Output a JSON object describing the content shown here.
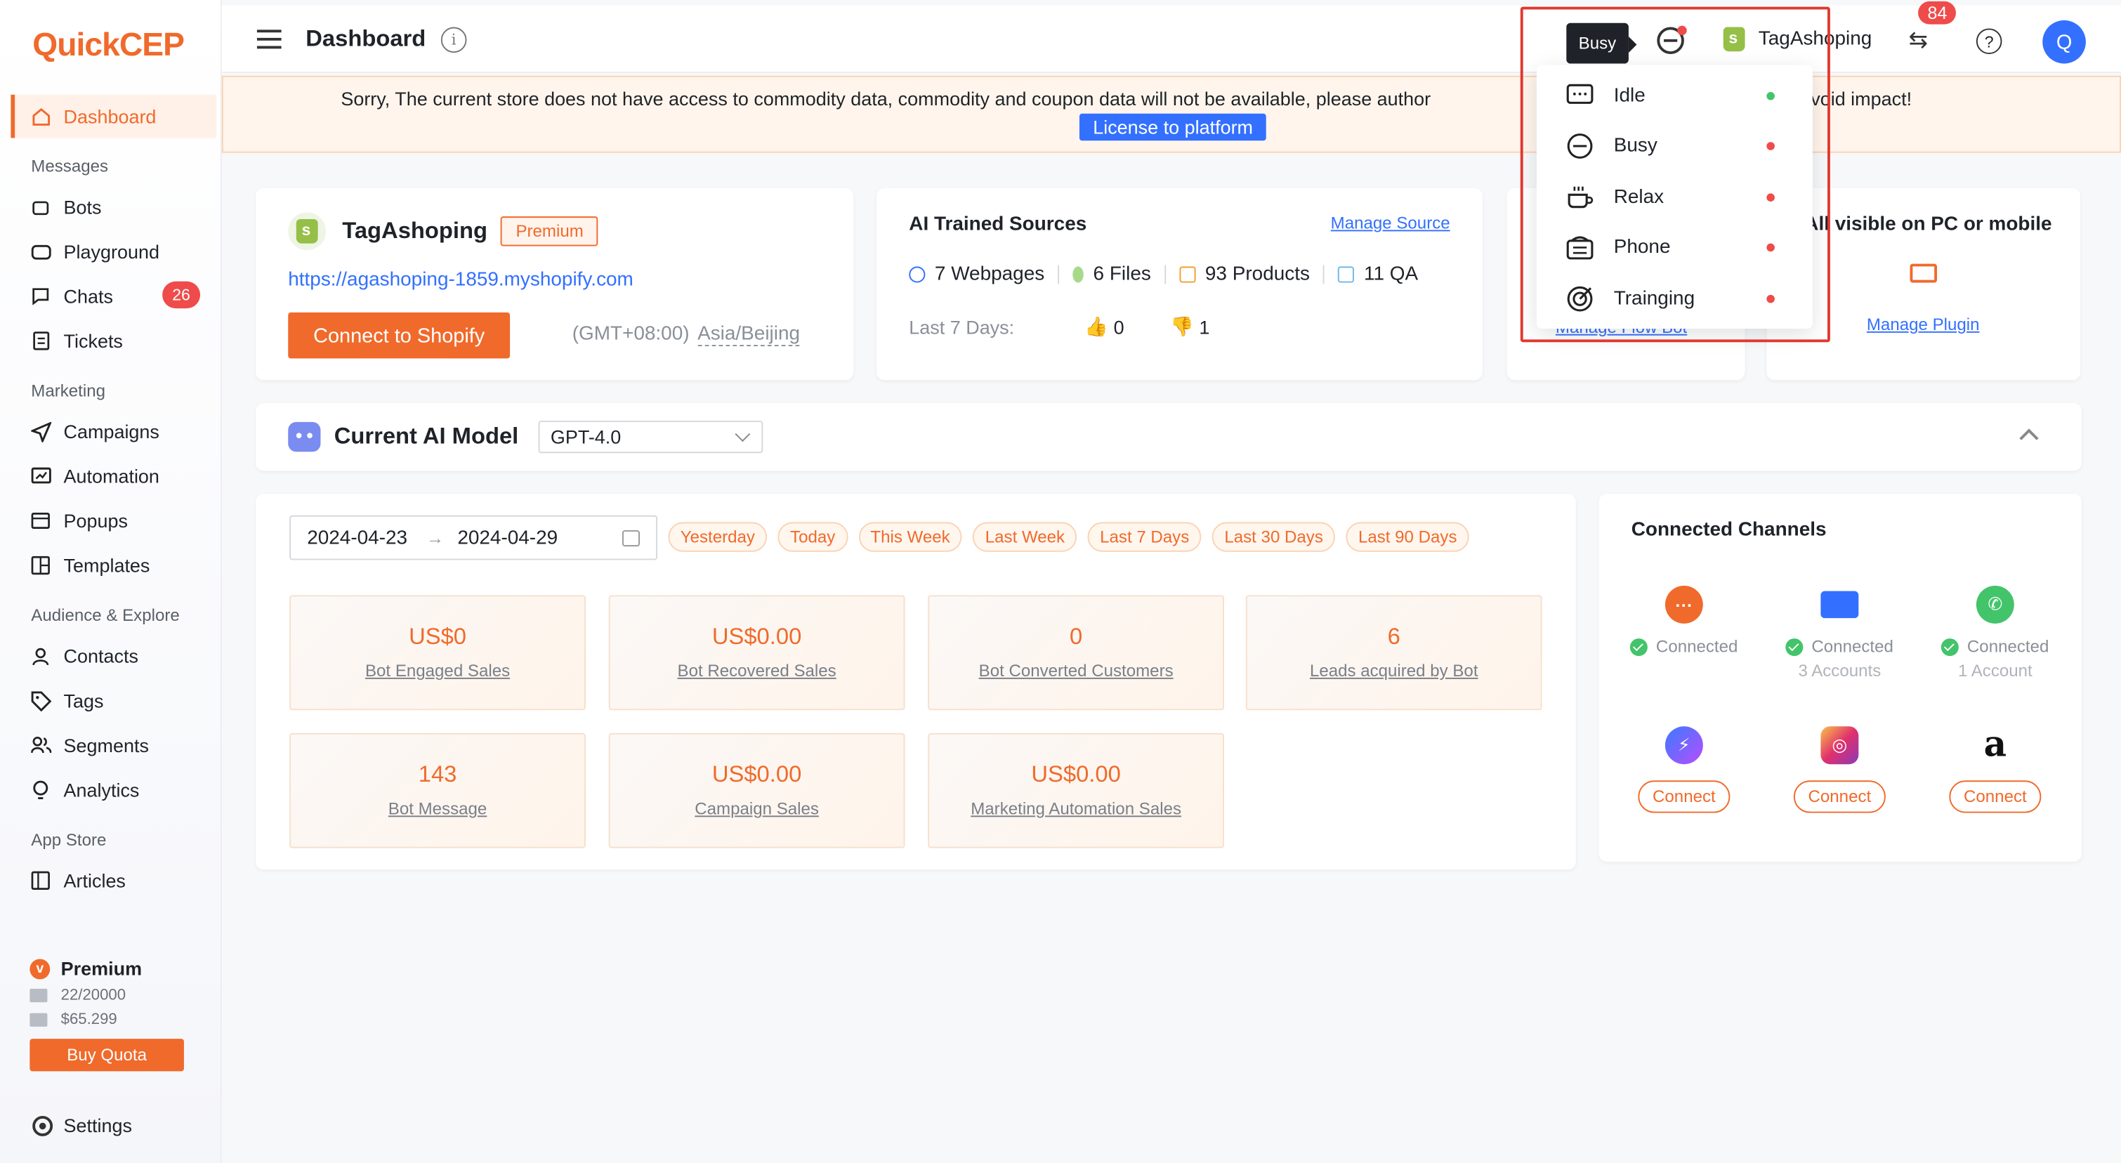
{
  "app": {
    "logo_text": "QuickCEP",
    "brand_color": "#f06a2b",
    "accent_color": "#3370ff"
  },
  "sidebar": {
    "dashboard": "Dashboard",
    "sections": {
      "messages": "Messages",
      "marketing": "Marketing",
      "audience": "Audience & Explore",
      "app_store": "App Store"
    },
    "items": {
      "bots": "Bots",
      "playground": "Playground",
      "chats": "Chats",
      "chats_badge": "26",
      "tickets": "Tickets",
      "campaigns": "Campaigns",
      "automation": "Automation",
      "popups": "Popups",
      "templates": "Templates",
      "contacts": "Contacts",
      "tags": "Tags",
      "segments": "Segments",
      "analytics": "Analytics",
      "articles": "Articles"
    },
    "plan": {
      "name": "Premium",
      "quota_messages": "22/20000",
      "quota_balance": "$65.299",
      "buy_label": "Buy Quota"
    },
    "settings": "Settings"
  },
  "header": {
    "title": "Dashboard",
    "info_glyph": "i",
    "store_name": "TagAshoping",
    "notifications": "84",
    "avatar_letter": "Q",
    "help_glyph": "?"
  },
  "banner": {
    "text_left": "Sorry, The current store does not have access to commodity data, commodity and coupon data will not be available, please author",
    "text_right": "order to avoid impact!",
    "button": "License to platform"
  },
  "store_card": {
    "name": "TagAshoping",
    "tag": "Premium",
    "url": "https://agashoping-1859.myshopify.com",
    "connect_label": "Connect to Shopify",
    "timezone": "(GMT+08:00)",
    "city": "Asia/Beijing"
  },
  "ai_sources": {
    "title": "AI Trained Sources",
    "manage_link": "Manage Source",
    "webpages_count": "7",
    "webpages_label": "Webpages",
    "files_count": "6",
    "files_label": "Files",
    "products_count": "93",
    "products_label": "Products",
    "qa_count": "11",
    "qa_label": "QA",
    "last7_label": "Last 7 Days:",
    "thumbs_up": "0",
    "thumbs_down": "1"
  },
  "flow_card": {
    "link": "Manage Flow Bot"
  },
  "plugin_card": {
    "title": "All visible on PC or mobile",
    "link": "Manage Plugin"
  },
  "model": {
    "label": "Current AI Model",
    "selected": "GPT-4.0"
  },
  "stats": {
    "date_from": "2024-04-23",
    "date_arrow": "→",
    "date_to": "2024-04-29",
    "presets": [
      "Yesterday",
      "Today",
      "This Week",
      "Last Week",
      "Last 7 Days",
      "Last 30 Days",
      "Last 90 Days"
    ],
    "metrics": [
      {
        "value": "US$0",
        "label": "Bot Engaged Sales"
      },
      {
        "value": "US$0.00",
        "label": "Bot Recovered Sales"
      },
      {
        "value": "0",
        "label": "Bot Converted Customers"
      },
      {
        "value": "6",
        "label": "Leads acquired by Bot"
      },
      {
        "value": "143",
        "label": "Bot Message"
      },
      {
        "value": "US$0.00",
        "label": "Campaign Sales"
      },
      {
        "value": "US$0.00",
        "label": "Marketing Automation Sales"
      }
    ]
  },
  "channels": {
    "title": "Connected Channels",
    "items": [
      {
        "name": "livechat",
        "status": "Connected",
        "sub": ""
      },
      {
        "name": "email",
        "status": "Connected",
        "sub": "3 Accounts"
      },
      {
        "name": "whatsapp",
        "status": "Connected",
        "sub": "1 Account"
      },
      {
        "name": "messenger",
        "action": "Connect"
      },
      {
        "name": "instagram",
        "action": "Connect"
      },
      {
        "name": "amazon",
        "action": "Connect",
        "glyph": "a"
      }
    ]
  },
  "status_menu": {
    "tooltip": "Busy",
    "options": [
      {
        "label": "Idle",
        "color": "#43c46b"
      },
      {
        "label": "Busy",
        "color": "#ef4b4b"
      },
      {
        "label": "Relax",
        "color": "#ef4b4b"
      },
      {
        "label": "Phone",
        "color": "#ef4b4b"
      },
      {
        "label": "Trainging",
        "color": "#ef4b4b"
      }
    ]
  }
}
